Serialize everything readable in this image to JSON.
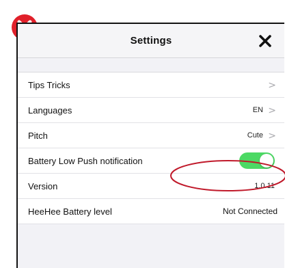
{
  "header": {
    "title": "Settings"
  },
  "icons": {
    "error": "x-circle-icon",
    "close": "close-x-icon",
    "chevron": "chevron-right-icon"
  },
  "colors": {
    "error_red": "#e0202a",
    "toggle_on": "#4cd964",
    "annotation": "#c0192a"
  },
  "settings": {
    "tips": {
      "label": "Tips Tricks",
      "chevron": ">"
    },
    "languages": {
      "label": "Languages",
      "value": "EN",
      "chevron": ">"
    },
    "pitch": {
      "label": "Pitch",
      "value": "Cute",
      "chevron": ">"
    },
    "battery_push": {
      "label": "Battery Low Push notification",
      "toggle_on": true
    },
    "version": {
      "label": "Version",
      "value": "1.0.11"
    },
    "battery_level": {
      "label": "HeeHee Battery level",
      "value": "Not Connected"
    }
  }
}
